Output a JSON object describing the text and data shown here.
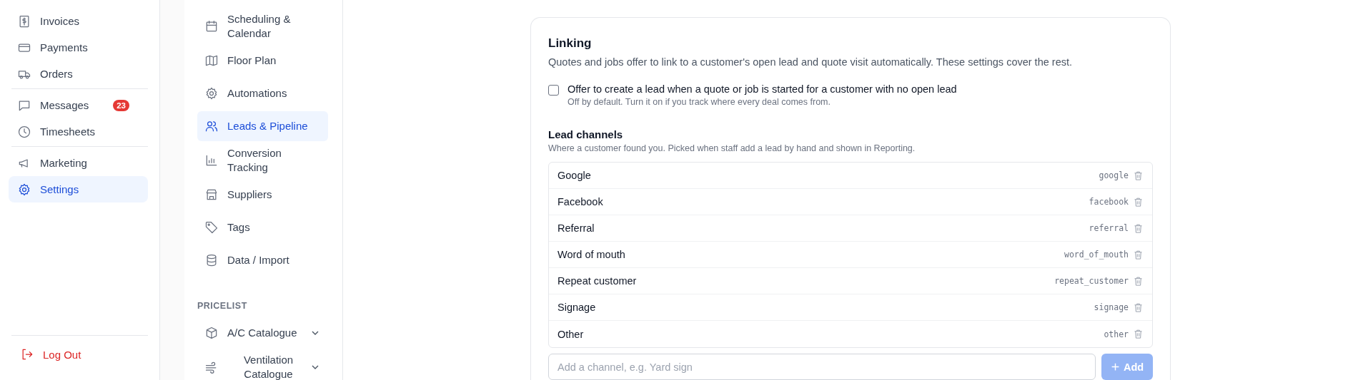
{
  "sidebar": {
    "groups": [
      {
        "items": [
          {
            "label": "Invoices",
            "selected": false
          },
          {
            "label": "Payments",
            "selected": false
          },
          {
            "label": "Orders",
            "selected": false
          }
        ]
      },
      {
        "items": [
          {
            "label": "Messages",
            "selected": false,
            "badge": "23"
          },
          {
            "label": "Timesheets",
            "selected": false
          }
        ]
      },
      {
        "items": [
          {
            "label": "Marketing",
            "selected": false
          },
          {
            "label": "Settings",
            "selected": true
          }
        ]
      }
    ],
    "logout": {
      "label": "Log Out"
    }
  },
  "settings_nav": {
    "items": [
      {
        "label": "Scheduling & Calendar",
        "selected": false
      },
      {
        "label": "Floor Plan",
        "selected": false
      },
      {
        "label": "Automations",
        "selected": false
      },
      {
        "label": "Leads & Pipeline",
        "selected": true
      },
      {
        "label": "Conversion Tracking",
        "selected": false
      },
      {
        "label": "Suppliers",
        "selected": false
      },
      {
        "label": "Tags",
        "selected": false
      },
      {
        "label": "Data / Import",
        "selected": false
      }
    ],
    "pricelist": {
      "heading": "PRICELIST",
      "items": [
        {
          "label": "A/C Catalogue",
          "expanded": false
        },
        {
          "label": "Ventilation Catalogue",
          "expanded": false
        }
      ]
    }
  },
  "linking": {
    "title": "Linking",
    "description": "Quotes and jobs offer to link to a customer's open lead and quote visit automatically. These settings cover the rest.",
    "option": {
      "label": "Offer to create a lead when a quote or job is started for a customer with no open lead",
      "hint": "Off by default. Turn it on if you track where every deal comes from.",
      "checked": false
    }
  },
  "lead_channels": {
    "title": "Lead channels",
    "description": "Where a customer found you. Picked when staff add a lead by hand and shown in Reporting.",
    "channels": [
      {
        "name": "Google",
        "key": "google"
      },
      {
        "name": "Facebook",
        "key": "facebook"
      },
      {
        "name": "Referral",
        "key": "referral"
      },
      {
        "name": "Word of mouth",
        "key": "word_of_mouth"
      },
      {
        "name": "Repeat customer",
        "key": "repeat_customer"
      },
      {
        "name": "Signage",
        "key": "signage"
      },
      {
        "name": "Other",
        "key": "other"
      }
    ],
    "input": {
      "placeholder": "Add a channel, e.g. Yard sign"
    },
    "add_button": {
      "label": "Add",
      "disabled": true
    }
  }
}
